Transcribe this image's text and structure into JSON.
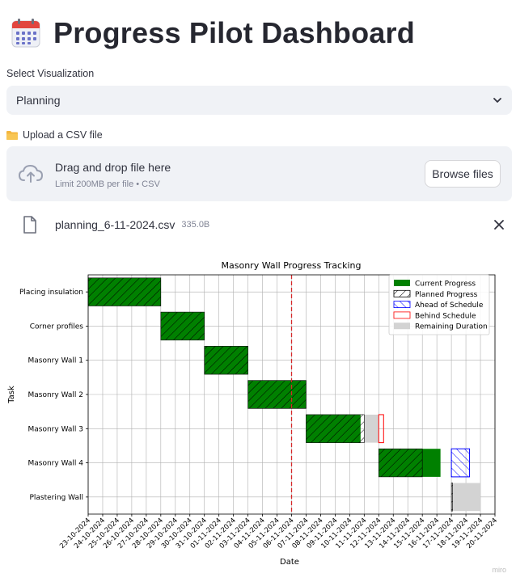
{
  "app": {
    "title": "Progress Pilot Dashboard",
    "icon": "calendar-icon"
  },
  "visualization": {
    "label": "Select Visualization",
    "selected": "Planning",
    "icon": "chevron-down-icon"
  },
  "upload": {
    "label": "Upload a CSV file",
    "label_icon": "folder-icon",
    "dropzone_title": "Drag and drop file here",
    "dropzone_subtitle": "Limit 200MB per file • CSV",
    "browse_label": "Browse files",
    "icon": "cloud-upload-icon"
  },
  "uploaded_file": {
    "name": "planning_6-11-2024.csv",
    "size": "335.0B",
    "icon": "file-icon",
    "remove_icon": "close-icon"
  },
  "watermark": "miro",
  "colors": {
    "current": "#008000",
    "ahead": "#0000ff",
    "behind": "#ff0000",
    "remaining": "#d3d3d3",
    "today_line": "#d62728",
    "accent_blue": "#4a5da8"
  },
  "chart_data": {
    "type": "gantt",
    "title": "Masonry Wall Progress Tracking",
    "xlabel": "Date",
    "ylabel": "Task",
    "grid": true,
    "legend_position": "top-right",
    "legend": [
      "Current Progress",
      "Planned Progress",
      "Ahead of Schedule",
      "Behind Schedule",
      "Remaining Duration"
    ],
    "x_ticks": [
      "23-10-2024",
      "24-10-2024",
      "25-10-2024",
      "26-10-2024",
      "27-10-2024",
      "28-10-2024",
      "29-10-2024",
      "30-10-2024",
      "31-10-2024",
      "01-11-2024",
      "02-11-2024",
      "03-11-2024",
      "04-11-2024",
      "05-11-2024",
      "06-11-2024",
      "07-11-2024",
      "08-11-2024",
      "09-11-2024",
      "10-11-2024",
      "11-11-2024",
      "12-11-2024",
      "13-11-2024",
      "14-11-2024",
      "15-11-2024",
      "16-11-2024",
      "17-11-2024",
      "18-11-2024",
      "19-11-2024",
      "20-11-2024"
    ],
    "xlim": [
      "23-10-2024",
      "20-11-2024"
    ],
    "today": "06-11-2024",
    "tasks": [
      "Placing insulation",
      "Corner profiles",
      "Masonry Wall 1",
      "Masonry Wall 2",
      "Masonry Wall 3",
      "Masonry Wall 4",
      "Plastering Wall"
    ],
    "bars": [
      {
        "task": "Placing insulation",
        "kind": "current",
        "start": "23-10-2024",
        "end": "28-10-2024"
      },
      {
        "task": "Placing insulation",
        "kind": "planned",
        "start": "23-10-2024",
        "end": "28-10-2024"
      },
      {
        "task": "Corner profiles",
        "kind": "current",
        "start": "28-10-2024",
        "end": "31-10-2024"
      },
      {
        "task": "Corner profiles",
        "kind": "planned",
        "start": "28-10-2024",
        "end": "31-10-2024"
      },
      {
        "task": "Masonry Wall 1",
        "kind": "current",
        "start": "31-10-2024",
        "end": "03-11-2024"
      },
      {
        "task": "Masonry Wall 1",
        "kind": "planned",
        "start": "31-10-2024",
        "end": "03-11-2024"
      },
      {
        "task": "Masonry Wall 2",
        "kind": "current",
        "start": "03-11-2024",
        "end": "07-11-2024"
      },
      {
        "task": "Masonry Wall 2",
        "kind": "planned",
        "start": "03-11-2024",
        "end": "07-11-2024"
      },
      {
        "task": "Masonry Wall 3",
        "kind": "current",
        "start": "07-11-2024",
        "end": "10-11-2024 18:00"
      },
      {
        "task": "Masonry Wall 3",
        "kind": "planned",
        "start": "07-11-2024",
        "end": "11-11-2024"
      },
      {
        "task": "Masonry Wall 3",
        "kind": "remaining",
        "start": "11-11-2024",
        "end": "12-11-2024"
      },
      {
        "task": "Masonry Wall 3",
        "kind": "behind",
        "start": "12-11-2024",
        "end": "12-11-2024 08:00"
      },
      {
        "task": "Masonry Wall 4",
        "kind": "current",
        "start": "12-11-2024",
        "end": "16-11-2024 06:00"
      },
      {
        "task": "Masonry Wall 4",
        "kind": "planned",
        "start": "12-11-2024",
        "end": "15-11-2024"
      },
      {
        "task": "Masonry Wall 4",
        "kind": "ahead",
        "start": "17-11-2024",
        "end": "18-11-2024 06:00"
      },
      {
        "task": "Plastering Wall",
        "kind": "remaining",
        "start": "17-11-2024",
        "end": "19-11-2024"
      },
      {
        "task": "Plastering Wall",
        "kind": "planned",
        "start": "17-11-2024",
        "end": "17-11-2024 02:00"
      }
    ]
  }
}
